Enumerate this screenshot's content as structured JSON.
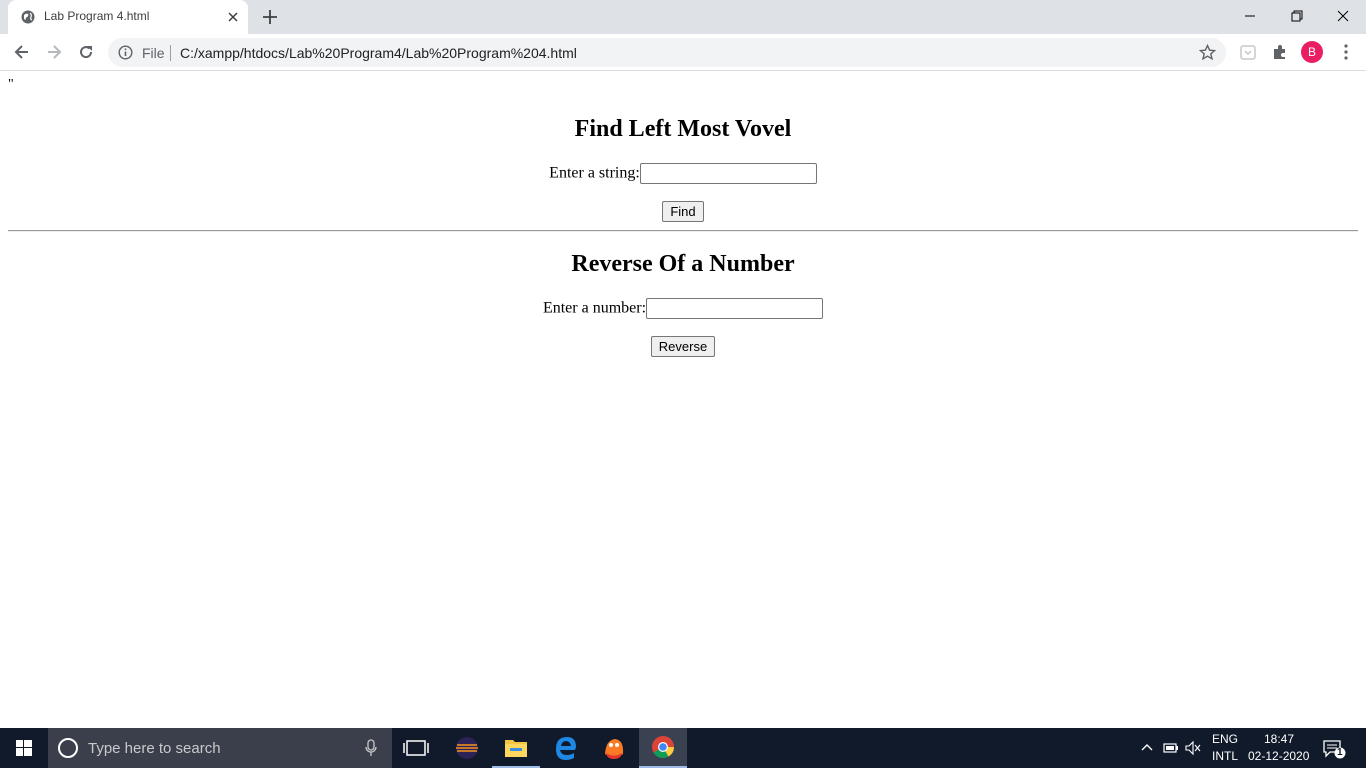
{
  "browser": {
    "tab_title": "Lab Program 4.html",
    "omnibox_scheme_label": "File",
    "url": "C:/xampp/htdocs/Lab%20Program4/Lab%20Program%204.html",
    "profile_initial": "B"
  },
  "page": {
    "stray_text": "\"",
    "vowel_section": {
      "heading": "Find Left Most Vovel",
      "input_label": "Enter a string:",
      "input_value": "",
      "button_label": "Find"
    },
    "reverse_section": {
      "heading": "Reverse Of a Number",
      "input_label": "Enter a number:",
      "input_value": "",
      "button_label": "Reverse"
    }
  },
  "taskbar": {
    "search_placeholder": "Type here to search",
    "language_primary": "ENG",
    "language_secondary": "INTL",
    "time": "18:47",
    "date": "02-12-2020",
    "notification_count": "1"
  },
  "colors": {
    "tab_strip": "#dee1e6",
    "taskbar": "#101a2a",
    "avatar": "#e91e63"
  }
}
